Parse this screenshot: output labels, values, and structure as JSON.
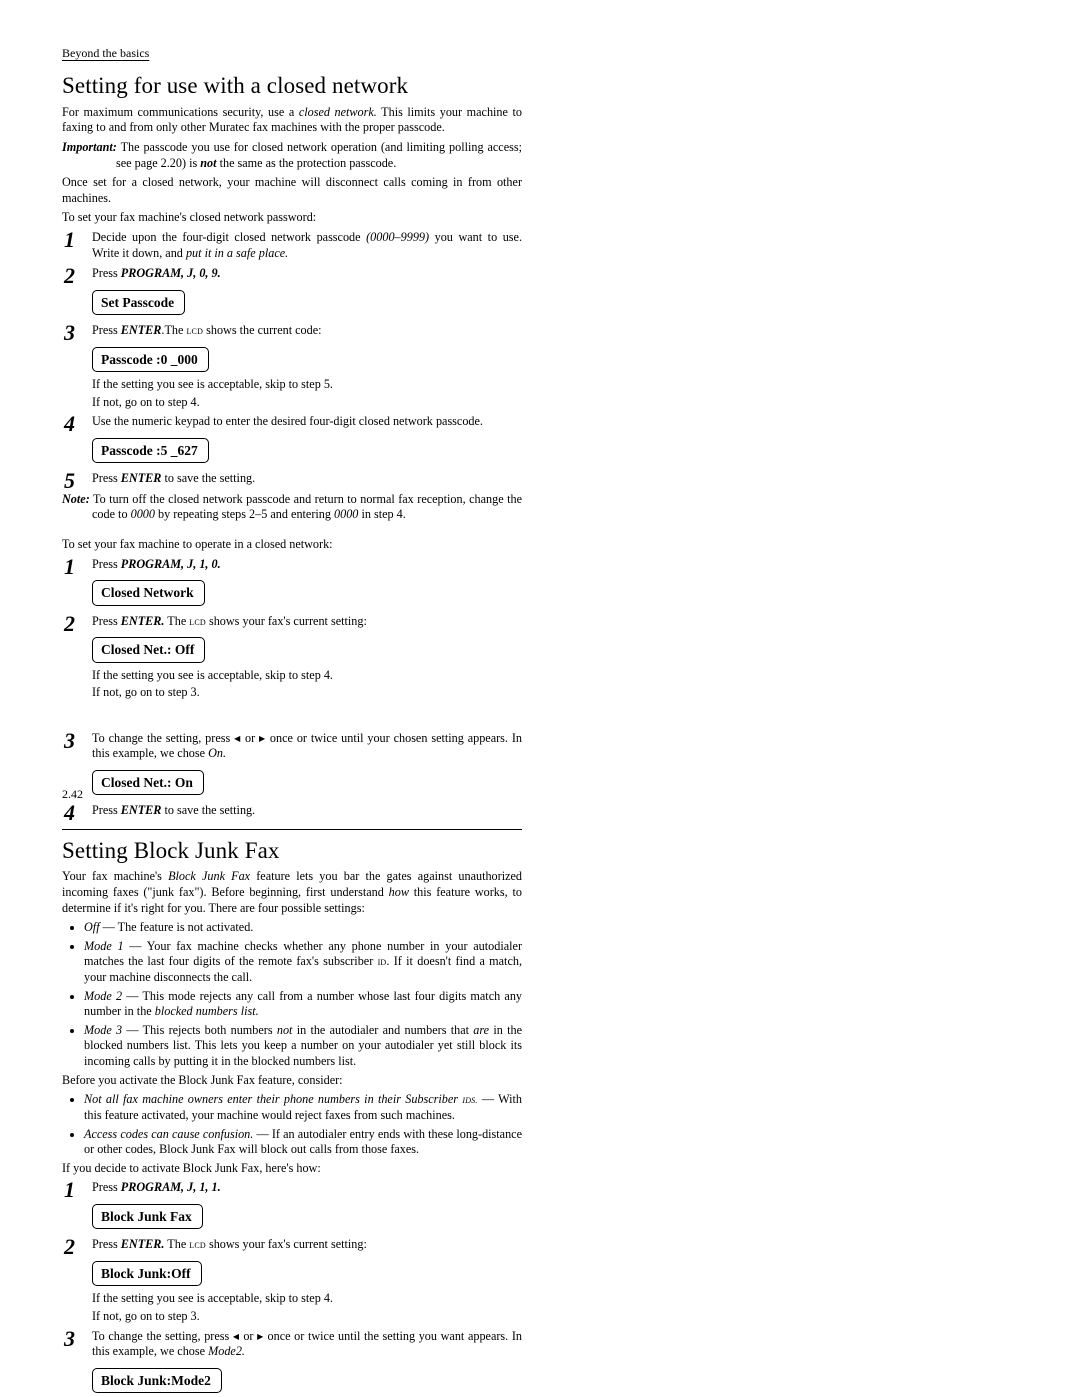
{
  "breadcrumb": "Beyond the basics",
  "page_number": "2.42",
  "left": {
    "title": "Setting for use with a closed network",
    "intro1": "For maximum communications security, use a ",
    "intro1_em": "closed network.",
    "intro1_cont": " This limits your machine to faxing to and from only other Muratec fax machines with the proper passcode.",
    "important_label": "Important:",
    "important": " The passcode you use for closed network operation (and limiting polling access; see page 2.20) is ",
    "important_not": "not",
    "important_after": " the same as the protection passcode.",
    "once_set": "Once set for a closed network, your machine will disconnect calls coming in from other machines.",
    "to_set_pw": "To set your fax machine's closed network password:",
    "step1a": "Decide upon the four-digit closed network passcode ",
    "step1a_em": "(0000–9999)",
    "step1a_cont": " you want to use. Write it down, and ",
    "step1a_em2": "put it in a safe place.",
    "step2a_press": "Press ",
    "step2a_keys": "PROGRAM, J, 0, 9.",
    "lcd_set_passcode": "Set Passcode",
    "step3a_a": "Press ",
    "step3a_b": "ENTER",
    "step3a_c": ".The ",
    "step3a_d": " shows the current code:",
    "lcd_passcode0": "Passcode   :0 _000",
    "skip5": "If the setting you see is acceptable, skip to step 5.",
    "gonot4": "If not, go on to step 4.",
    "step4a": "Use the numeric keypad to enter the desired four-digit closed network passcode.",
    "lcd_passcode5": "Passcode   :5 _627",
    "step5a_a": "Press ",
    "step5a_b": "ENTER",
    "step5a_c": " to save the setting.",
    "note_label": "Note:",
    "note_body": " To turn off the closed network passcode and return to normal fax reception, change the code to ",
    "note_0000a": "0000",
    "note_body2": " by repeating steps 2–5 and entering ",
    "note_0000b": "0000",
    "note_body3": " in step 4.",
    "to_set_net": "To set your fax machine to operate in a closed network:",
    "step1b_press": "Press ",
    "step1b_keys": "PROGRAM, J, 1, 0.",
    "lcd_closed_network": "Closed Network",
    "step2b_a": "Press ",
    "step2b_b": "ENTER.",
    "step2b_c": " The ",
    "step2b_d": " shows your fax's current setting:",
    "lcd_closed_off": "Closed Net.: Off",
    "skip4": "If the setting you see is acceptable, skip to step 4.",
    "gonot3": "If not, go on to step 3."
  },
  "right": {
    "step3_top_a": "To change the setting, press ",
    "step3_top_b": " once or twice until your chosen setting appears. In this example, we chose ",
    "step3_top_on": "On.",
    "lcd_closed_on": "Closed Net.: On",
    "step4_top_a": "Press ",
    "step4_top_b": "ENTER",
    "step4_top_c": " to save the setting.",
    "title2": "Setting Block Junk Fax",
    "p1a": "Your fax machine's ",
    "p1b": "Block Junk Fax",
    "p1c": " feature lets you bar the gates against unauthorized incoming faxes (\"junk fax\"). Before beginning, first understand ",
    "p1d": "how",
    "p1e": " this feature works, to determine if it's right for you. There are four possible settings:",
    "b_off_a": "Off",
    "b_off_b": " — The feature is not activated.",
    "b_m1_a": "Mode 1",
    "b_m1_b": " — Your fax machine checks whether any phone number in your autodialer matches the last four digits of the remote fax's subscriber ",
    "b_m1_c": ". If it doesn't find a match, your machine disconnects the call.",
    "b_m2_a": "Mode 2",
    "b_m2_b": " — This mode rejects any call from a number whose last four digits match any number in the ",
    "b_m2_c": "blocked numbers list.",
    "b_m3_a": "Mode 3",
    "b_m3_b": " — This rejects both numbers ",
    "b_m3_not": "not",
    "b_m3_c": " in the autodialer and numbers that ",
    "b_m3_are": "are",
    "b_m3_d": " in the blocked numbers list. This lets you keep a number on your autodialer yet still block its incoming calls by putting it in the blocked numbers list.",
    "before": "Before you activate the Block Junk Fax feature, consider:",
    "c1_a": "Not all fax machine owners enter their phone numbers in their Subscriber ",
    "c1_b": " — With this feature activated, your machine would reject faxes from such machines.",
    "c2_a": "Access codes can cause confusion.",
    "c2_b": " — If an autodialer entry ends with these long-distance or other codes, Block Junk Fax will block out calls from those faxes.",
    "decide": "If you decide to activate Block Junk Fax, here's how:",
    "step1_press": "Press ",
    "step1_keys": "PROGRAM, J, 1, 1.",
    "lcd_block": "Block Junk Fax",
    "step2_a": "Press ",
    "step2_b": "ENTER.",
    "step2_c": " The ",
    "step2_d": " shows your fax's current setting:",
    "lcd_block_off": "Block Junk:Off",
    "skip4r": "If the setting you see is acceptable, skip to step 4.",
    "gonot3r": "If not, go on to step 3.",
    "step3_a": "To change the setting, press ",
    "step3_b": " once or twice until the setting you want appears. In this example, we chose ",
    "step3_mode2": "Mode2.",
    "lcd_block_mode2": "Block Junk:Mode2"
  }
}
